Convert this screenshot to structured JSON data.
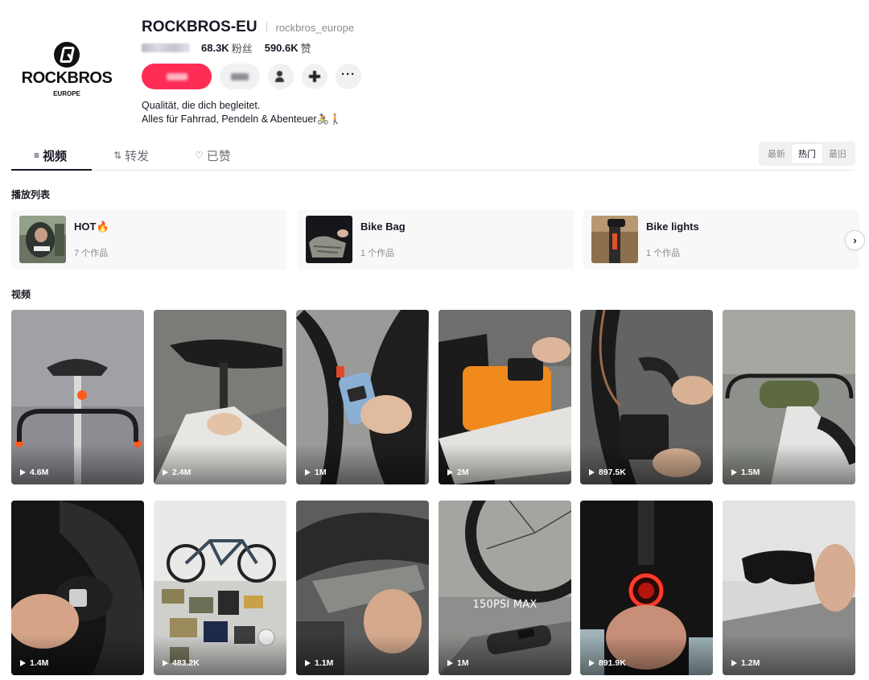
{
  "profile": {
    "logo_text": "ROCKBROS",
    "logo_subtext": "EUROPE",
    "display_name": "ROCKBROS-EU",
    "handle": "rockbros_europe",
    "followers_value": "68.3K",
    "followers_label": "粉丝",
    "likes_value": "590.6K",
    "likes_label": "赞",
    "bio_line1": "Qualität, die dich begleitet.",
    "bio_line2": "Alles für Fahrrad, Pendeln & Abenteuer🚴🏽🚶🏼"
  },
  "actions": {
    "more_label": "···"
  },
  "tabs": [
    {
      "label": "视频",
      "icon": "≡"
    },
    {
      "label": "转发",
      "icon": "⇅"
    },
    {
      "label": "已赞",
      "icon": "♡"
    }
  ],
  "sort": [
    "最新",
    "热门",
    "最旧"
  ],
  "sort_active": "热门",
  "playlists_title": "播放列表",
  "playlists": [
    {
      "title": "HOT🔥",
      "count": "7 个作品"
    },
    {
      "title": "Bike Bag",
      "count": "1 个作品"
    },
    {
      "title": "Bike lights",
      "count": "1 个作品"
    }
  ],
  "videos_title": "视频",
  "videos": [
    {
      "views": "4.6M"
    },
    {
      "views": "2.4M"
    },
    {
      "views": "1M"
    },
    {
      "views": "2M"
    },
    {
      "views": "897.5K"
    },
    {
      "views": "1.5M"
    },
    {
      "views": "1.4M"
    },
    {
      "views": "483.2K"
    },
    {
      "views": "1.1M"
    },
    {
      "views": "1M",
      "overlay": "150PSI MAX"
    },
    {
      "views": "891.9K"
    },
    {
      "views": "1.2M"
    }
  ],
  "colors": {
    "accent": "#fe2c55",
    "text_primary": "#161823",
    "text_secondary": "#8a8b91"
  }
}
